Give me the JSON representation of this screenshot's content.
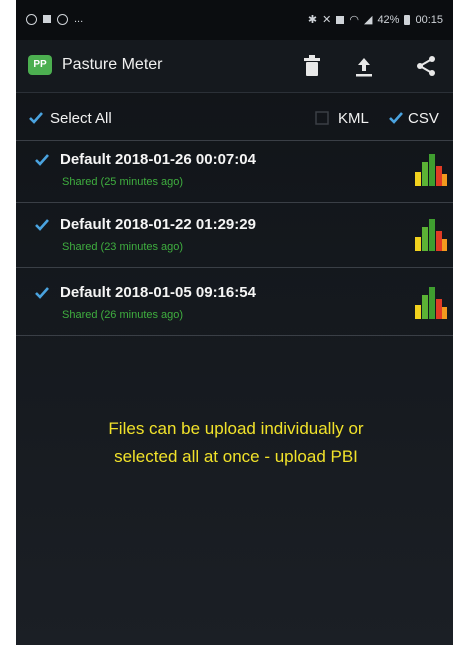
{
  "status_bar": {
    "left_indicator": "...",
    "battery": "42%",
    "time": "00:15"
  },
  "app": {
    "logo_text": "PP",
    "title": "Pasture Meter",
    "actions": [
      "delete-icon",
      "upload-icon",
      "share-icon"
    ]
  },
  "select_row": {
    "select_all_label": "Select All",
    "select_all_checked": true,
    "kml_label": "KML",
    "kml_checked": false,
    "csv_label": "CSV",
    "csv_checked": true
  },
  "files": [
    {
      "title": "Default 2018-01-26 00:07:04",
      "status": "Shared (25 minutes ago)",
      "checked": true
    },
    {
      "title": "Default 2018-01-22 01:29:29",
      "status": "Shared (23 minutes ago)",
      "checked": true
    },
    {
      "title": "Default 2018-01-05 09:16:54",
      "status": "Shared (26 minutes ago)",
      "checked": true
    }
  ],
  "annotation": {
    "line1": "Files can be upload individually or",
    "line2": "selected all at once - upload PBI"
  },
  "colors": {
    "check": "#4aa3df",
    "shared_green": "#3fae3f",
    "annotation_yellow": "#f1e22a",
    "logo_green": "#4caf50"
  }
}
